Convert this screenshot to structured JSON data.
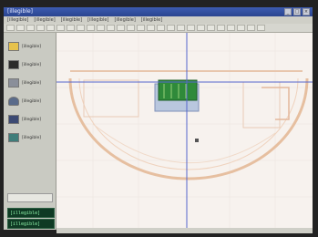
{
  "window": {
    "title": "[illegible]"
  },
  "menu": {
    "items": [
      "[illegible]",
      "[illegible]",
      "[illegible]",
      "[illegible]",
      "[illegible]",
      "[illegible]"
    ]
  },
  "palette": {
    "tools": [
      {
        "label": "[illegible]",
        "icon": "folder-icon"
      },
      {
        "label": "[illegible]",
        "icon": "monitor-icon"
      },
      {
        "label": "[illegible]",
        "icon": "layer-icon"
      },
      {
        "label": "[illegible]",
        "icon": "person-icon"
      },
      {
        "label": "[illegible]",
        "icon": "camera-icon"
      },
      {
        "label": "[illegible]",
        "icon": "render-icon"
      }
    ],
    "status": [
      "[illegible]",
      "[illegible]"
    ]
  },
  "colors": {
    "accent": "#3d5bb0",
    "canvas": "#f7f2ee",
    "guide": "#5566cc",
    "selection": "#2f8a3a"
  }
}
